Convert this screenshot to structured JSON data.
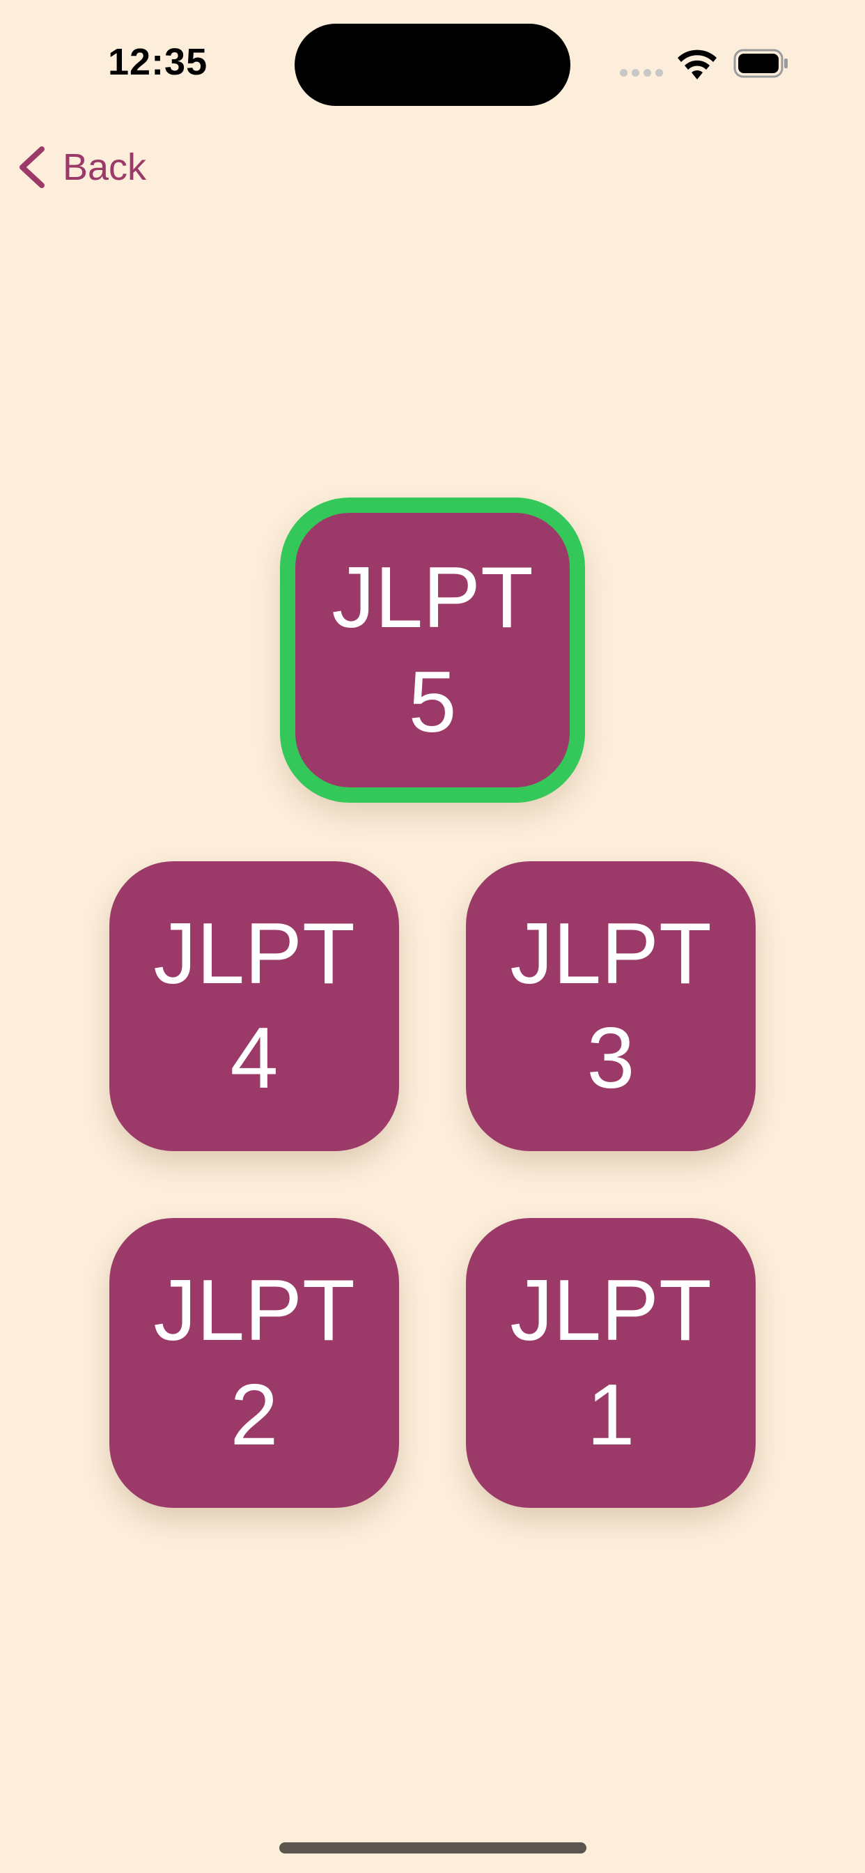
{
  "status_bar": {
    "time": "12:35",
    "icons": [
      "cellular-signal-icon",
      "wifi-icon",
      "battery-icon"
    ]
  },
  "nav": {
    "back_label": "Back",
    "back_icon": "chevron-left-icon"
  },
  "levels": [
    {
      "label": "JLPT",
      "number": "5",
      "selected": true
    },
    {
      "label": "JLPT",
      "number": "4",
      "selected": false
    },
    {
      "label": "JLPT",
      "number": "3",
      "selected": false
    },
    {
      "label": "JLPT",
      "number": "2",
      "selected": false
    },
    {
      "label": "JLPT",
      "number": "1",
      "selected": false
    }
  ],
  "colors": {
    "background": "#FCEEDB",
    "tile": "#9B3A69",
    "selected_border": "#34C759",
    "accent": "#9B3A69"
  }
}
